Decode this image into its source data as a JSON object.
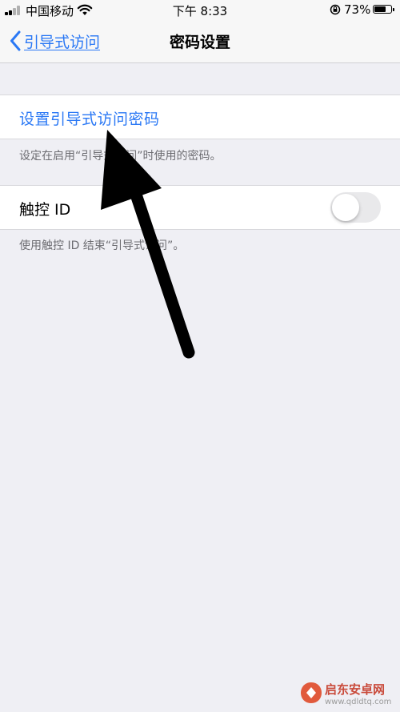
{
  "status_bar": {
    "carrier": "中国移动",
    "time": "下午 8:33",
    "battery_percent": "73%",
    "battery_level": 0.73
  },
  "nav": {
    "back_label": "引导式访问",
    "title": "密码设置"
  },
  "passcode_section": {
    "set_passcode_label": "设置引导式访问密码",
    "footer": "设定在启用“引导式访问”时使用的密码。"
  },
  "touch_id_section": {
    "label": "触控 ID",
    "toggle_on": false,
    "footer": "使用触控 ID 结束“引导式访问”。"
  },
  "icons": {
    "back": "chevron-left-icon",
    "wifi": "wifi-icon",
    "signal": "cellular-signal-icon",
    "lock": "orientation-lock-icon",
    "battery": "battery-icon"
  },
  "colors": {
    "accent": "#2a78f5",
    "background": "#efeff4",
    "footer_text": "#6d6d72",
    "toggle_off": "#e9e9eb"
  },
  "watermark": {
    "title": "启东安卓网",
    "url": "www.qdldtq.com"
  }
}
